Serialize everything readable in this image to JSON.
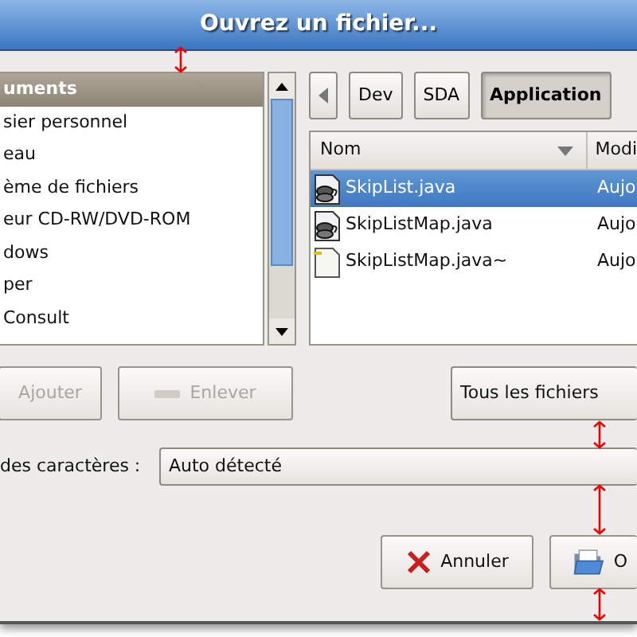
{
  "window": {
    "title": "Ouvrez un fichier..."
  },
  "places": [
    {
      "label": "uments",
      "selected": true
    },
    {
      "label": "sier personnel",
      "selected": false
    },
    {
      "label": "eau",
      "selected": false
    },
    {
      "label": "ème de fichiers",
      "selected": false
    },
    {
      "label": "eur CD-RW/DVD-ROM",
      "selected": false
    },
    {
      "label": "dows",
      "selected": false
    },
    {
      "label": "per",
      "selected": false
    },
    {
      "label": "Consult",
      "selected": false
    }
  ],
  "path_bar": [
    {
      "label": "Dev",
      "selected": false
    },
    {
      "label": "SDA",
      "selected": false
    },
    {
      "label": "Application",
      "selected": true
    }
  ],
  "file_list": {
    "columns": [
      "Nom",
      "Modi"
    ],
    "rows": [
      {
        "name": "SkipList.java",
        "modified": "Aujo",
        "kind": "java",
        "selected": true
      },
      {
        "name": "SkipListMap.java",
        "modified": "Aujo",
        "kind": "java",
        "selected": false
      },
      {
        "name": "SkipListMap.java~",
        "modified": "Aujo",
        "kind": "text",
        "selected": false
      }
    ]
  },
  "place_buttons": [
    {
      "label": "Ajouter",
      "kind": "add",
      "disabled": true
    },
    {
      "label": "Enlever",
      "kind": "remove",
      "disabled": true
    }
  ],
  "filter": {
    "value": "Tous les fichiers"
  },
  "encoding": {
    "label": "des caractères :",
    "value": "Auto détecté"
  },
  "buttons": [
    {
      "label": "Annuler",
      "kind": "cancel"
    },
    {
      "label": "O",
      "kind": "open"
    }
  ]
}
